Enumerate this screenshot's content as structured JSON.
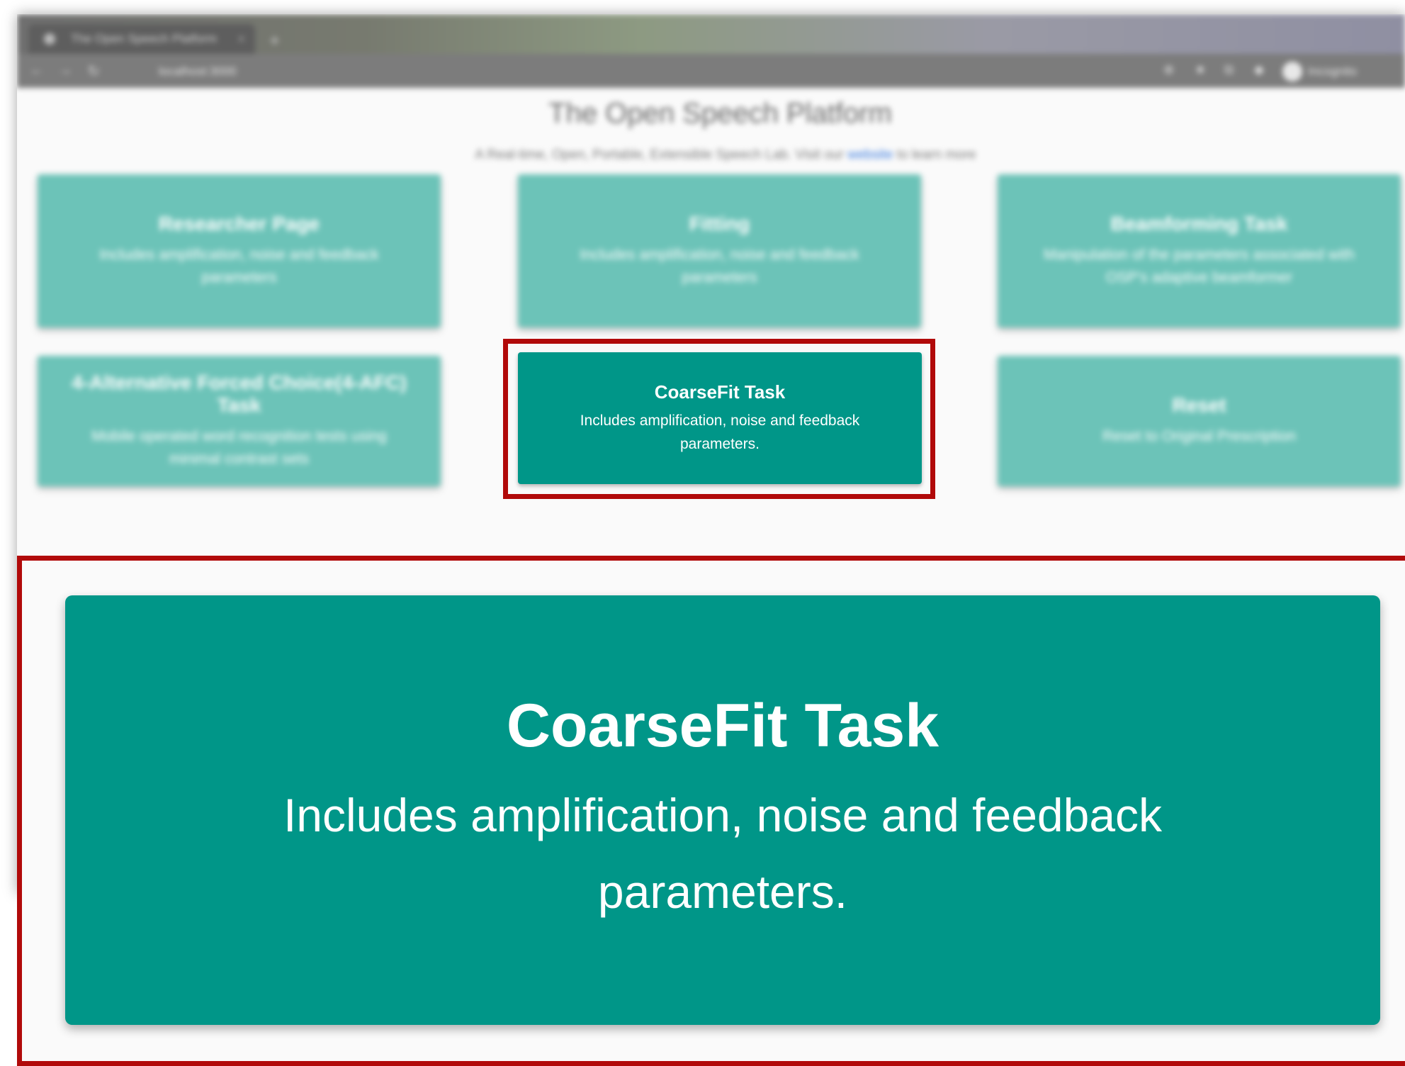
{
  "browser": {
    "tab_title": "The Open Speech Platform",
    "tab_close": "×",
    "new_tab": "+",
    "back": "←",
    "forward": "→",
    "reload": "↻",
    "url": "localhost:3000",
    "profile_label": "Incognito"
  },
  "page": {
    "title": "The Open Speech Platform",
    "subtitle": "A Real-time, Open, Portable, Extensible Speech Lab. Visit our",
    "subtitle_link": "website",
    "subtitle_end": "to learn more"
  },
  "cards": [
    {
      "title": "Researcher Page",
      "desc": "Includes amplification, noise and feedback parameters"
    },
    {
      "title": "Fitting",
      "desc": "Includes amplification, noise and feedback parameters"
    },
    {
      "title": "Beamforming Task",
      "desc": "Manipulation of the parameters associated with OSP's adaptive beamformer"
    },
    {
      "title": "4-Alternative Forced Choice(4-AFC) Task",
      "desc": "Mobile operated word recognition tests using minimal contrast sets"
    },
    {
      "title": "CoarseFit Task",
      "desc": "Includes amplification, noise and feedback parameters."
    },
    {
      "title": "Reset",
      "desc": "Reset to Original Prescription"
    }
  ],
  "highlight_color": "#b10a0a",
  "card_color": "#009688"
}
